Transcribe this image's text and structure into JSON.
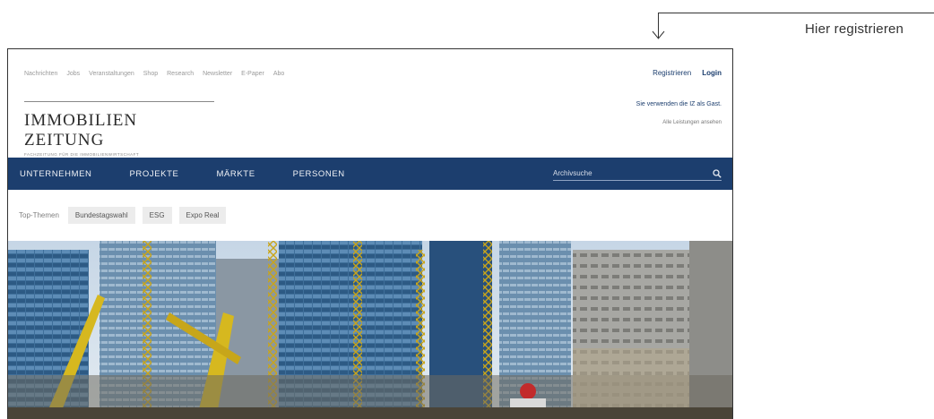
{
  "callout": {
    "label": "Hier registrieren"
  },
  "top_nav": {
    "items": [
      "Nachrichten",
      "Jobs",
      "Veranstaltungen",
      "Shop",
      "Research",
      "Newsletter",
      "E-Paper",
      "Abo"
    ]
  },
  "account": {
    "register_label": "Registrieren",
    "login_label": "Login"
  },
  "guest": {
    "notice": "Sie verwenden die IZ als Gast.",
    "link": "Alle Leistungen ansehen"
  },
  "logo": {
    "brand": "IMMOBILIEN ZEITUNG",
    "tagline": "FACHZEITUNG FÜR DIE IMMOBILIENWIRTSCHAFT"
  },
  "main_nav": {
    "items": [
      "UNTERNEHMEN",
      "PROJEKTE",
      "MÄRKTE",
      "PERSONEN"
    ],
    "search_placeholder": "Archivsuche"
  },
  "topics": {
    "label": "Top-Themen",
    "chips": [
      "Bundestagswahl",
      "ESG",
      "Expo Real"
    ]
  },
  "colors": {
    "brand_navy": "#1c3e6e",
    "chip_bg": "#ececec"
  },
  "icons": [
    "search-icon",
    "arrow-down-icon"
  ]
}
